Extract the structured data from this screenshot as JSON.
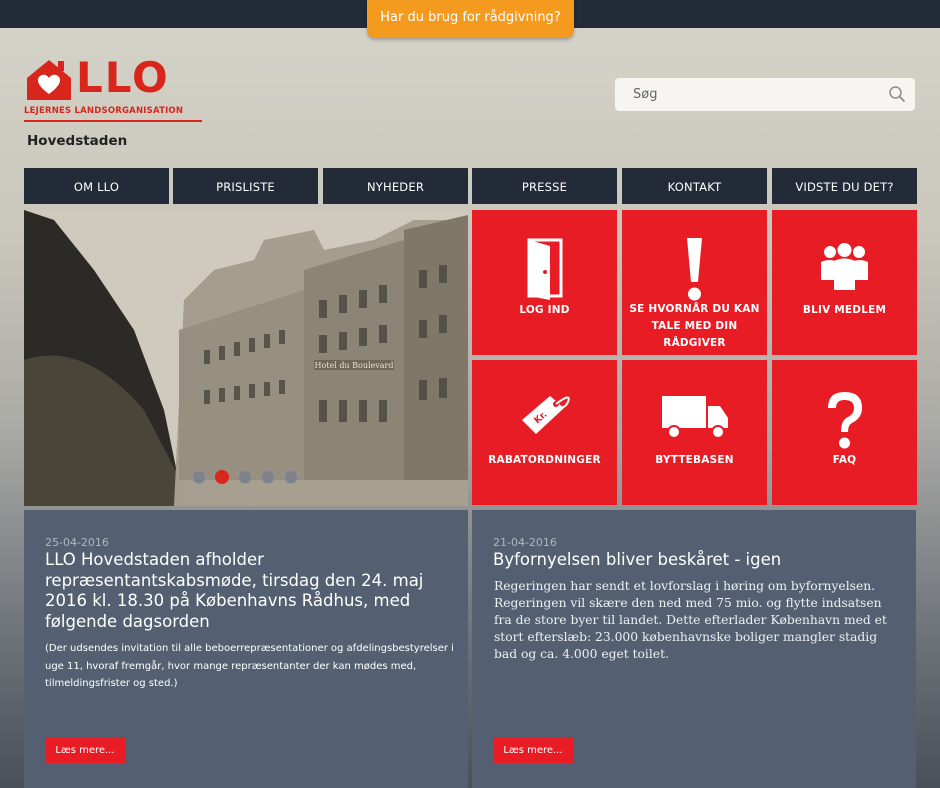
{
  "top_banner": {
    "cta_label": "Har du brug for rådgivning?"
  },
  "header": {
    "logo_text": "LLO",
    "logo_subtitle": "LEJERNES LANDSORGANISATION",
    "region": "Hovedstaden",
    "search_placeholder": "Søg",
    "brand_color": "#d9261c"
  },
  "nav": {
    "items": [
      {
        "label": "OM LLO"
      },
      {
        "label": "PRISLISTE"
      },
      {
        "label": "NYHEDER"
      },
      {
        "label": "PRESSE"
      },
      {
        "label": "KONTAKT"
      },
      {
        "label": "VIDSTE DU DET?"
      }
    ]
  },
  "slider": {
    "sign_text": "Hotel du Boulevard",
    "dot_count": 5,
    "active_dot": 2
  },
  "tiles": [
    {
      "label": "LOG IND",
      "icon": "door-icon"
    },
    {
      "label": "SE HVORNÅR DU KAN TALE MED DIN RÅDGIVER",
      "icon": "exclamation-icon"
    },
    {
      "label": "BLIV MEDLEM",
      "icon": "people-group-icon"
    },
    {
      "label": "RABATORDNINGER",
      "icon": "price-tag-icon"
    },
    {
      "label": "BYTTEBASEN",
      "icon": "truck-icon"
    },
    {
      "label": "FAQ",
      "icon": "question-mark-icon"
    }
  ],
  "news": [
    {
      "date": "25-04-2016",
      "title": "LLO Hovedstaden afholder repræsentantskabsmøde, tirsdag den 24. maj 2016 kl. 18.30 på Københavns Rådhus, med følgende dagsorden",
      "excerpt": "(Der udsendes invitation til alle beboerrepræsentationer og afdelingsbestyrelser i uge 11, hvoraf fremgår, hvor mange repræsentanter der kan mødes med, tilmeldingsfrister og sted.)",
      "read_more": "Læs mere..."
    },
    {
      "date": "21-04-2016",
      "title": "Byfornyelsen bliver beskåret - igen",
      "excerpt": "Regeringen har sendt et lovforslag i høring om byfornyelsen. Regeringen vil skære den ned med 75 mio. og flytte indsatsen fra de store byer til landet. Dette efterlader København med et stort efterslæb: 23.000 københavnske boliger mangler stadig bad og ca. 4.000 eget toilet.",
      "read_more": "Læs mere..."
    }
  ],
  "colors": {
    "nav_bg": "#232a38",
    "tile_red": "#e81c24",
    "cta_orange": "#f39a1f",
    "news_bg": "#546071"
  }
}
